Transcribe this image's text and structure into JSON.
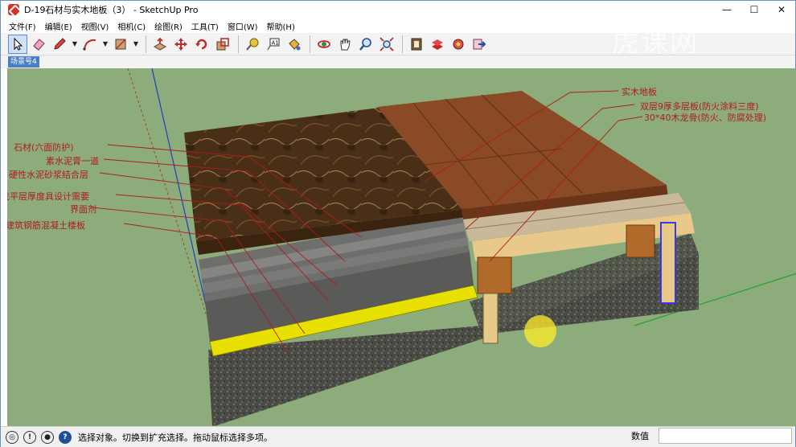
{
  "window": {
    "title": "D-19石材与实木地板（3） - SketchUp Pro",
    "minimize": "—",
    "maximize": "☐",
    "close": "✕"
  },
  "menu": [
    "文件(F)",
    "编辑(E)",
    "视图(V)",
    "相机(C)",
    "绘图(R)",
    "工具(T)",
    "窗口(W)",
    "帮助(H)"
  ],
  "toolbar": {
    "tools": [
      "select-icon",
      "eraser-icon",
      "pencil-icon",
      "arc-icon",
      "rectangle-icon",
      "push-pull-icon",
      "move-icon",
      "rotate-icon",
      "scale-icon",
      "tape-measure-icon",
      "text-icon",
      "paint-bucket-icon",
      "orbit-icon",
      "pan-icon",
      "zoom-icon",
      "zoom-extents-icon",
      "warehouse-icon",
      "extension-icon",
      "components-icon",
      "export-icon"
    ]
  },
  "scene": {
    "tab": "场景号4"
  },
  "labels": {
    "left": [
      "石材(六面防护)",
      "素水泥膏一道",
      "硬性水泥砂浆结合层",
      "找平层厚度具设计需要",
      "界面剂",
      "建筑钢筋混凝土楼板"
    ],
    "right": [
      "实木地板",
      "双层9厚多层板(防火涂料三度)",
      "30*40木龙骨(防火、防腐处理)"
    ]
  },
  "watermark": "虎课网",
  "status": {
    "text": "选择对象。切换到扩充选择。拖动鼠标选择多项。",
    "measure_label": "数值",
    "icons": [
      "geo-location-icon",
      "credits-icon",
      "user-icon",
      "info-icon"
    ]
  },
  "colors": {
    "viewport": "#8dac7c",
    "marble": "#4a2f18",
    "wood": "#8a4a25",
    "label_red": "#b11a1a",
    "yellow_layer": "#e8e000"
  }
}
